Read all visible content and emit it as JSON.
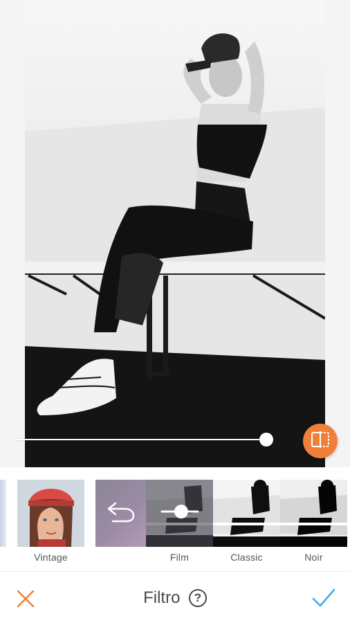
{
  "toolbar": {
    "title": "Filtro",
    "help_icon": "question-circle-icon",
    "cancel_icon": "close-icon",
    "confirm_icon": "checkmark-icon"
  },
  "colors": {
    "accent": "#f07f3a",
    "confirm": "#3fa9e8",
    "label": "#555555"
  },
  "intensity_slider": {
    "value_fraction": 0.97
  },
  "compare_button": {
    "icon": "split-compare-icon"
  },
  "filters": [
    {
      "id": "vintage",
      "label": "Vintage"
    },
    {
      "id": "undo",
      "label": ""
    },
    {
      "id": "film",
      "label": "Film",
      "selected": true
    },
    {
      "id": "classic",
      "label": "Classic"
    },
    {
      "id": "noir",
      "label": "Noir"
    }
  ]
}
